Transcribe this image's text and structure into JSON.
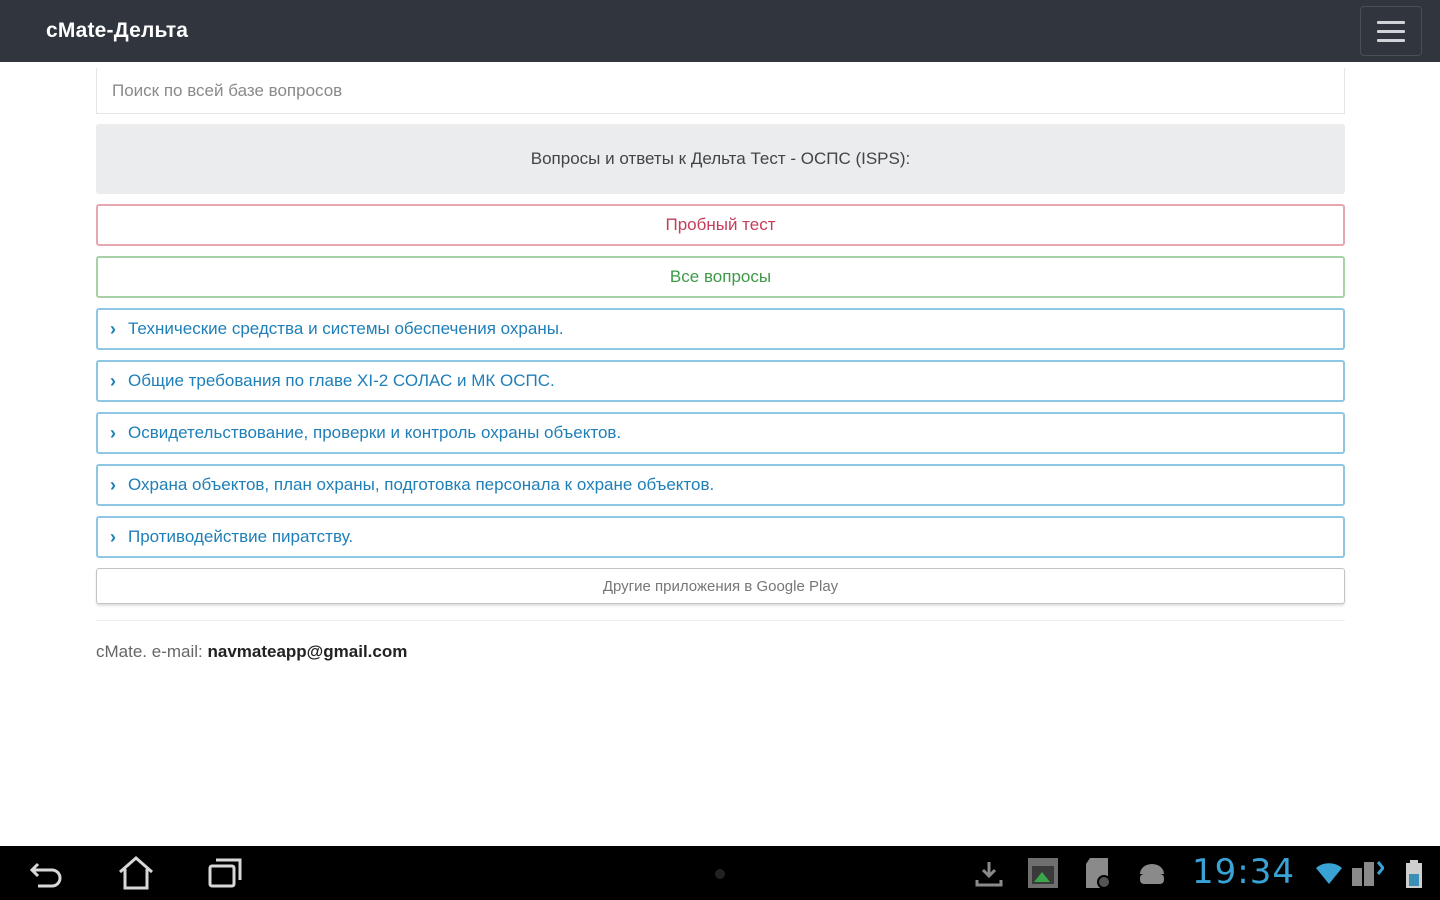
{
  "app": {
    "title": "cMate-Дельта"
  },
  "search": {
    "placeholder": "Поиск по всей базе вопросов"
  },
  "header_panel": {
    "text": "Вопросы и ответы к Дельта Тест - ОСПС (ISPS):"
  },
  "buttons": {
    "trial_test": "Пробный тест",
    "all_questions": "Все вопросы"
  },
  "topics": [
    "Технические средства и системы обеспечения охраны.",
    "Общие требования по главе XI-2 СОЛАС и МК ОСПС.",
    "Освидетельствование, проверки и контроль охраны объектов.",
    "Охрана объектов, план охраны, подготовка персонала к охране объектов.",
    "Противодействие пиратству."
  ],
  "other_apps": "Другие приложения в Google Play",
  "footer": {
    "prefix": "cMate. e-mail: ",
    "email": "navmateapp@gmail.com"
  },
  "system_bar": {
    "time": "19:34",
    "icons": [
      "back-icon",
      "home-icon",
      "recent-apps-icon",
      "download-icon",
      "gallery-icon",
      "sd-card-icon",
      "android-icon",
      "wifi-icon",
      "signal-icon",
      "battery-icon"
    ]
  },
  "colors": {
    "navbar": "#31363e",
    "trial_test": "#c53d5a",
    "all_questions": "#3e9a47",
    "topic": "#1f7fb8",
    "clock": "#3aa3d6"
  }
}
